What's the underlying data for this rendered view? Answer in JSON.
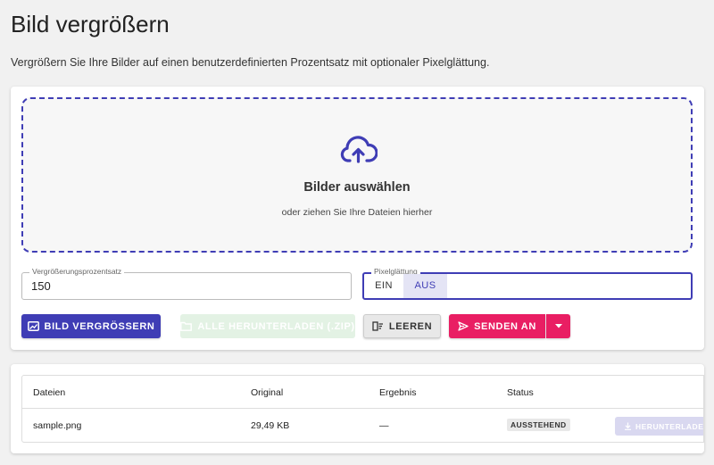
{
  "page": {
    "title": "Bild vergrößern",
    "subtitle": "Vergrößern Sie Ihre Bilder auf einen benutzerdefinierten Prozentsatz mit optionaler Pixelglättung."
  },
  "dropzone": {
    "icon": "cloud-upload-icon",
    "title": "Bilder auswählen",
    "subtitle": "oder ziehen Sie Ihre Dateien hierher"
  },
  "settings": {
    "percent_label": "Vergrößerungsprozentsatz",
    "percent_value": "150",
    "smoothing_label": "Pixelglättung",
    "smoothing_on": "EIN",
    "smoothing_off": "AUS",
    "smoothing_selected": "AUS"
  },
  "actions": {
    "enlarge": "BILD VERGRÖSSERN",
    "download_all": "ALLE HERUNTERLADEN (.ZIP)",
    "clear": "LEEREN",
    "send": "SENDEN AN"
  },
  "table": {
    "headers": [
      "Dateien",
      "Original",
      "Ergebnis",
      "Status"
    ],
    "rows": [
      {
        "file": "sample.png",
        "original": "29,49 KB",
        "result": "—",
        "status": "AUSSTEHEND",
        "download": "HERUNTERLADEN"
      }
    ]
  },
  "colors": {
    "primary": "#3f3db5",
    "accent": "#e91e63",
    "background": "#f1f1f1"
  }
}
